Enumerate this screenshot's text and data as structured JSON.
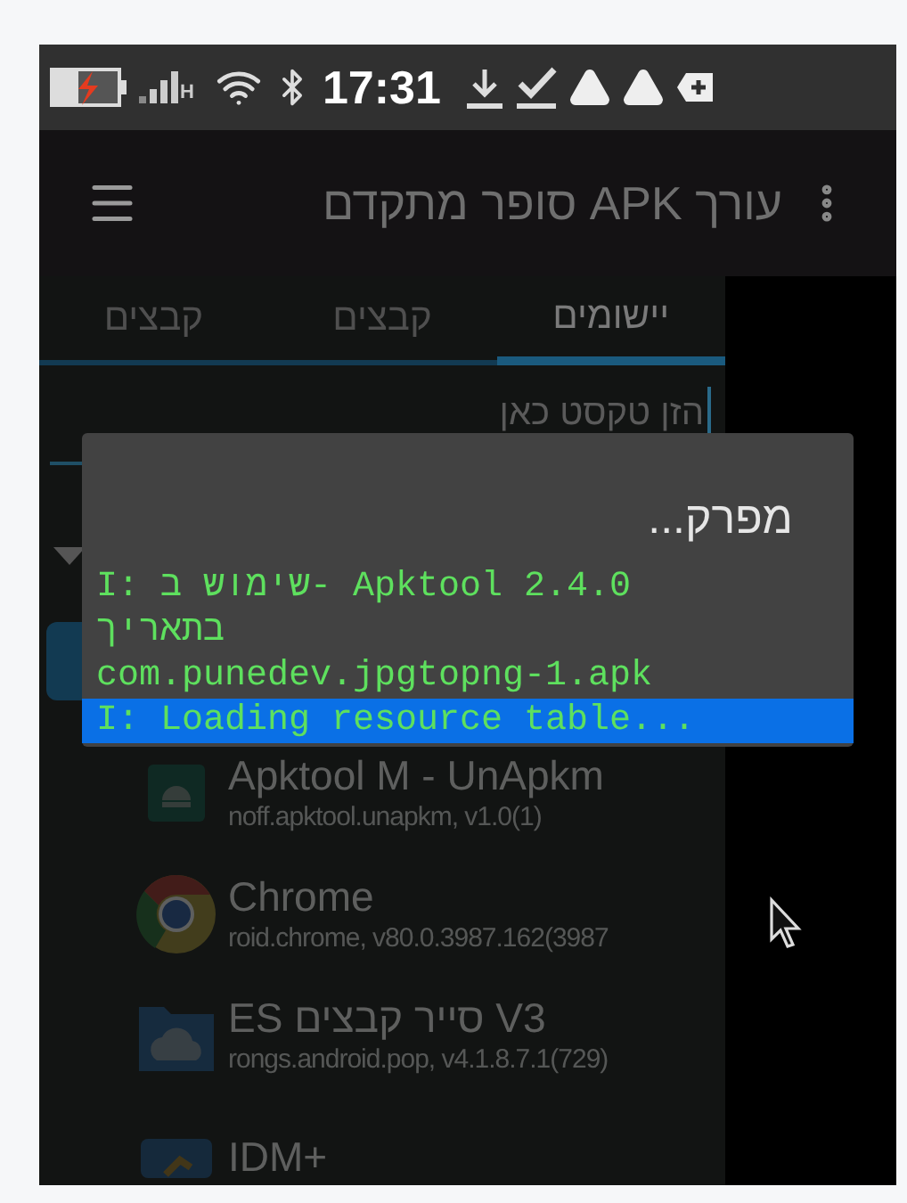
{
  "status_bar": {
    "network_type": "H",
    "time": "17:31"
  },
  "app_bar": {
    "title": "עורך APK סופר מתקדם"
  },
  "tabs": [
    {
      "label": "יישומים",
      "selected": true
    },
    {
      "label": "קבצים",
      "selected": false
    },
    {
      "label": "קבצים",
      "selected": false
    }
  ],
  "search": {
    "placeholder": "הזן טקסט כאן"
  },
  "apps": [
    {
      "kind": "android",
      "name": "Apktool M - UnApkm",
      "package": "noff.apktool.unapkm, v1.0(1)"
    },
    {
      "kind": "chrome",
      "name": "Chrome",
      "package": "roid.chrome, v80.0.3987.162(3987"
    },
    {
      "kind": "folder",
      "name": "ES סייר קבצים V3",
      "package": "rongs.android.pop, v4.1.8.7.1(729)"
    },
    {
      "kind": "download",
      "name": "IDM+"
    }
  ],
  "dialog": {
    "title": "מפרק...",
    "log": [
      {
        "text": "I: שימוש ב- Apktool 2.4.0 בתאריך com.punedev.jpgtopng-1.apk",
        "selected": false
      },
      {
        "text": "I: Loading resource table...",
        "selected": true
      }
    ]
  }
}
